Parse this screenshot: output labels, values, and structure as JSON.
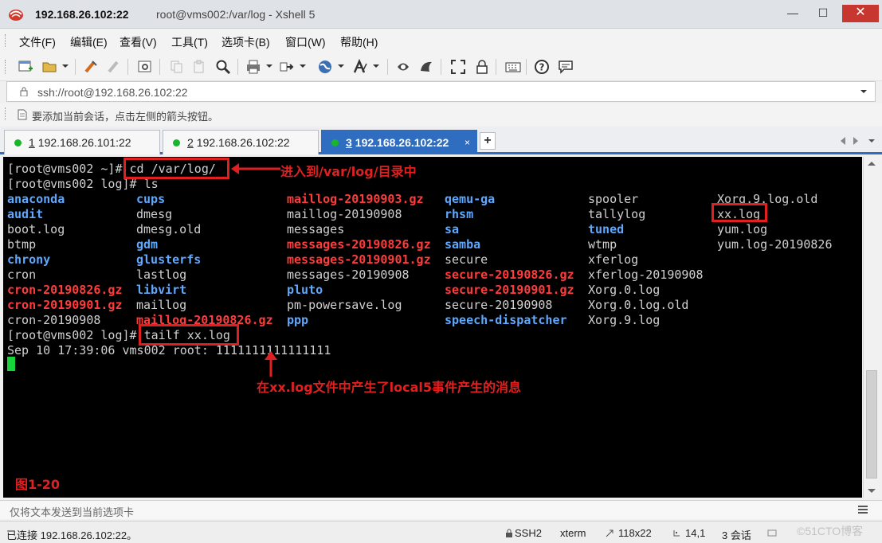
{
  "window": {
    "title_ip": "192.168.26.102:22",
    "title_rest": "root@vms002:/var/log - Xshell 5",
    "minimize": "—",
    "maximize": "☐",
    "close": "✕"
  },
  "menu": [
    "文件(F)",
    "编辑(E)",
    "查看(V)",
    "工具(T)",
    "选项卡(B)",
    "窗口(W)",
    "帮助(H)"
  ],
  "toolbar_icons": [
    "new-session-icon",
    "open-folder-icon",
    "reconnect-icon",
    "disconnect-icon",
    "properties-icon",
    "copy-icon",
    "paste-icon",
    "find-icon",
    "print-icon",
    "transfer-icon",
    "globe-icon",
    "font-icon",
    "xftp-icon",
    "xmanager-icon",
    "fullscreen-icon",
    "lock-icon",
    "keyboard-icon",
    "help-icon",
    "chat-icon"
  ],
  "address": {
    "url": "ssh://root@192.168.26.102:22"
  },
  "hint": {
    "text": "要添加当前会话，点击左侧的箭头按钮。"
  },
  "tabs": [
    {
      "num": "1",
      "label": "192.168.26.101:22",
      "active": false
    },
    {
      "num": "2",
      "label": "192.168.26.102:22",
      "active": false
    },
    {
      "num": "3",
      "label": "192.168.26.102:22",
      "active": true,
      "close": "×"
    }
  ],
  "tab_add": "+",
  "terminal": {
    "prompt1": "[root@vms002 ~]# ",
    "cmd1": "cd /var/log/",
    "prompt2": "[root@vms002 log]# ",
    "cmd2": "ls",
    "prompt3": "[root@vms002 log]# ",
    "cmd3": "tailf xx.log",
    "output": "Sep 10 17:39:06 vms002 root: 1111111111111111",
    "ls_columns": [
      [
        [
          "anaconda",
          "dir"
        ],
        [
          "audit",
          "dir"
        ],
        [
          "boot.log",
          "file"
        ],
        [
          "btmp",
          "file"
        ],
        [
          "chrony",
          "dir"
        ],
        [
          "cron",
          "file"
        ],
        [
          "cron-20190826.gz",
          "gz"
        ],
        [
          "cron-20190901.gz",
          "gz"
        ],
        [
          "cron-20190908",
          "file"
        ]
      ],
      [
        [
          "cups",
          "dir"
        ],
        [
          "dmesg",
          "file"
        ],
        [
          "dmesg.old",
          "file"
        ],
        [
          "gdm",
          "dir"
        ],
        [
          "glusterfs",
          "dir"
        ],
        [
          "lastlog",
          "file"
        ],
        [
          "libvirt",
          "dir"
        ],
        [
          "maillog",
          "file"
        ],
        [
          "maillog-20190826.gz",
          "gz"
        ]
      ],
      [
        [
          "maillog-20190903.gz",
          "gz"
        ],
        [
          "maillog-20190908",
          "file"
        ],
        [
          "messages",
          "file"
        ],
        [
          "messages-20190826.gz",
          "gz"
        ],
        [
          "messages-20190901.gz",
          "gz"
        ],
        [
          "messages-20190908",
          "file"
        ],
        [
          "pluto",
          "dir"
        ],
        [
          "pm-powersave.log",
          "file"
        ],
        [
          "ppp",
          "dir"
        ]
      ],
      [
        [
          "qemu-ga",
          "dir"
        ],
        [
          "rhsm",
          "dir"
        ],
        [
          "sa",
          "dir"
        ],
        [
          "samba",
          "dir"
        ],
        [
          "secure",
          "file"
        ],
        [
          "secure-20190826.gz",
          "gz"
        ],
        [
          "secure-20190901.gz",
          "gz"
        ],
        [
          "secure-20190908",
          "file"
        ],
        [
          "speech-dispatcher",
          "dir"
        ]
      ],
      [
        [
          "spooler",
          "file"
        ],
        [
          "tallylog",
          "file"
        ],
        [
          "tuned",
          "dir"
        ],
        [
          "wtmp",
          "file"
        ],
        [
          "xferlog",
          "file"
        ],
        [
          "xferlog-20190908",
          "file"
        ],
        [
          "Xorg.0.log",
          "file"
        ],
        [
          "Xorg.0.log.old",
          "file"
        ],
        [
          "Xorg.9.log",
          "file"
        ]
      ],
      [
        [
          "Xorg.9.log.old",
          "file"
        ],
        [
          "xx.log",
          "file"
        ],
        [
          "yum.log",
          "file"
        ],
        [
          "yum.log-20190826",
          "file"
        ]
      ]
    ]
  },
  "annotations": {
    "arrow1_text": "进入到/var/log/目录中",
    "arrow2_text": "在xx.log文件中产生了local5事件产生的消息",
    "figure_label": "图1-20",
    "color": "#e02020"
  },
  "compose": {
    "placeholder": "仅将文本发送到当前选项卡"
  },
  "status": {
    "connected": "已连接 192.168.26.102:22。",
    "protocol": "SSH2",
    "term": "xterm",
    "size": "118x22",
    "cursor": "14,1",
    "sessions": "3 会话",
    "watermark": "©51CTO博客"
  }
}
